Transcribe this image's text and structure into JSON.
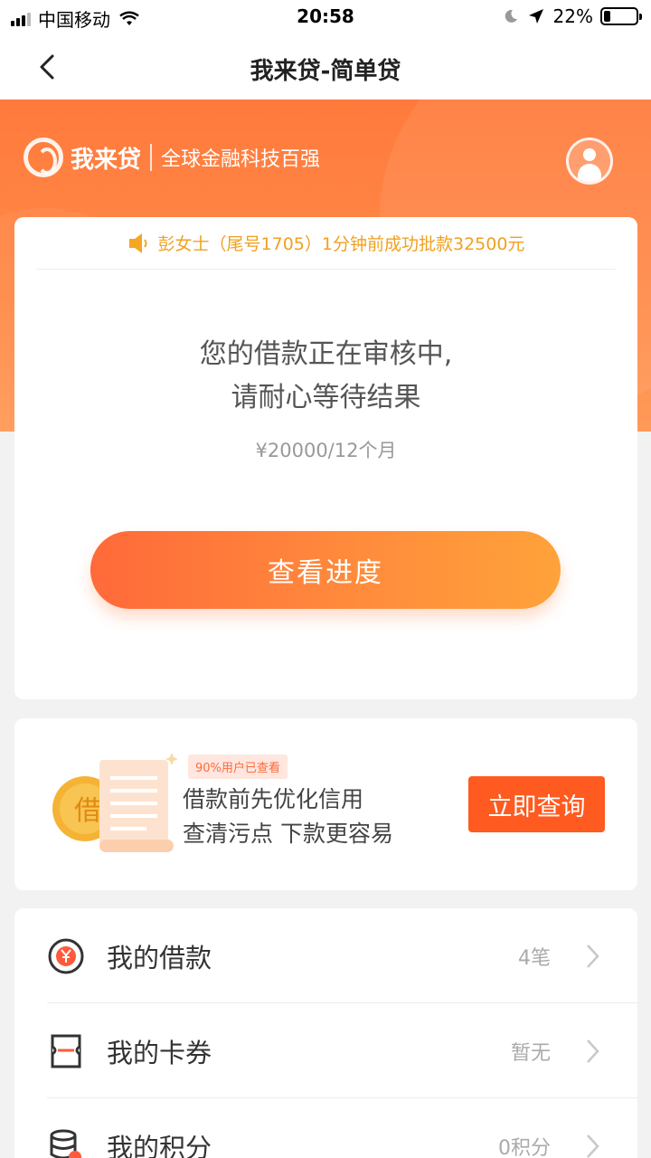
{
  "status_bar": {
    "carrier": "中国移动",
    "time": "20:58",
    "battery": "22%",
    "battery_level": 0.22
  },
  "nav": {
    "title": "我来贷-简单贷"
  },
  "brand": {
    "name": "我来贷",
    "slogan": "全球金融科技百强"
  },
  "notice": {
    "text": "彭女士（尾号1705）1分钟前成功批款32500元"
  },
  "review": {
    "line1": "您的借款正在审核中,",
    "line2": "请耐心等待结果",
    "amount": "¥20000/12个月",
    "button_label": "查看进度"
  },
  "promo": {
    "tag": "90%用户已查看",
    "line1": "借款前先优化信用",
    "line2": "查清污点 下款更容易",
    "button_label": "立即查询",
    "illustration_glyph": "借"
  },
  "menu": {
    "items": [
      {
        "label": "我的借款",
        "value": "4笔",
        "icon": "yuan-circle-icon"
      },
      {
        "label": "我的卡券",
        "value": "暂无",
        "icon": "ticket-icon"
      },
      {
        "label": "我的积分",
        "value": "0积分",
        "icon": "coins-icon"
      }
    ]
  },
  "colors": {
    "brand_orange": "#ff7a3c",
    "notice_text": "#f0a020",
    "promo_button": "#ff5a1f"
  }
}
